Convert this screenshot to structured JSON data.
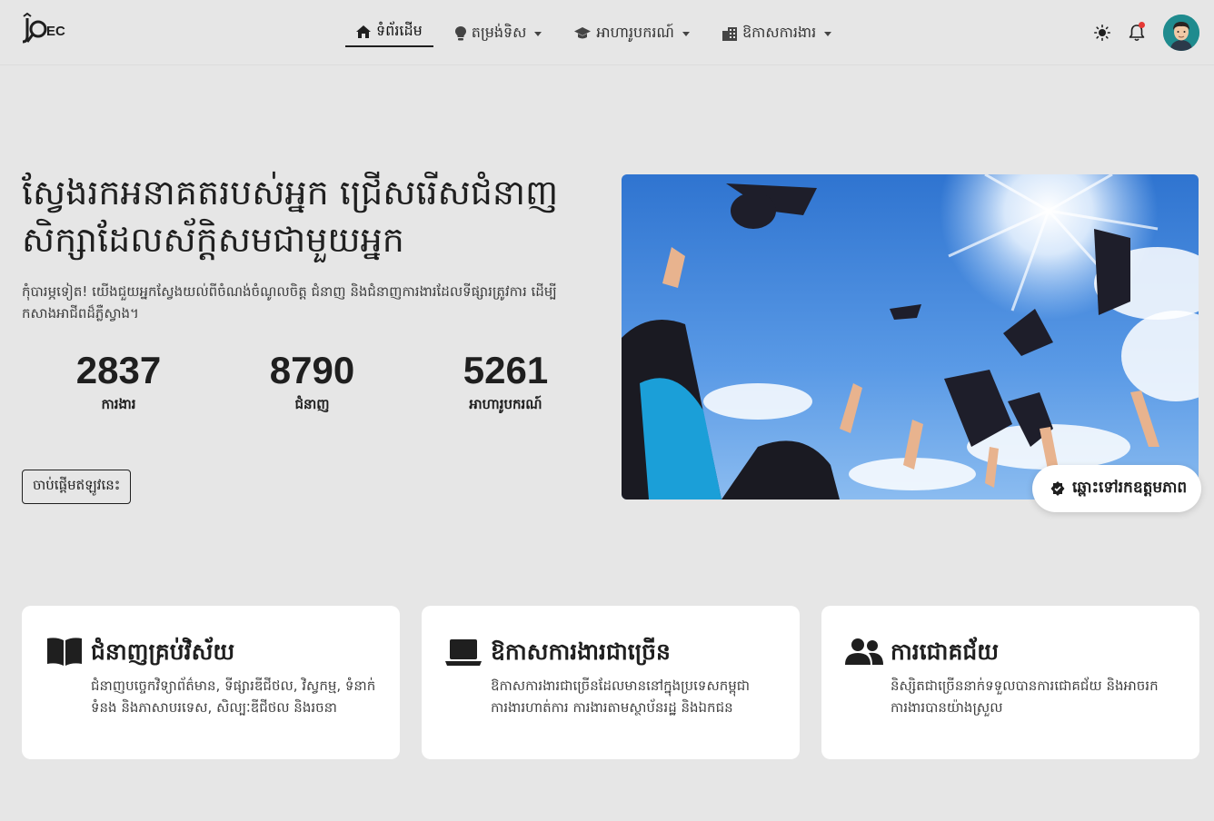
{
  "brand": {
    "logo_text": "JOEC"
  },
  "nav": {
    "items": [
      {
        "label": "ទំព័រដើម",
        "icon": "home-icon",
        "active": true,
        "dropdown": false
      },
      {
        "label": "តម្រង់ទិស",
        "icon": "lightbulb-icon",
        "active": false,
        "dropdown": true
      },
      {
        "label": "អាហារូបករណ៍",
        "icon": "graduation-cap-icon",
        "active": false,
        "dropdown": true
      },
      {
        "label": "ឱកាសការងារ",
        "icon": "building-icon",
        "active": false,
        "dropdown": true
      }
    ],
    "right": {
      "theme_icon": "sun-icon",
      "notification_icon": "bell-icon",
      "has_notification": true
    }
  },
  "hero": {
    "title": "ស្វែងរកអនាគតរបស់អ្នក ជ្រើសរើសជំនាញសិក្សាដែលស័ក្តិសមជាមួយអ្នក",
    "description": "កុំបារម្ភទៀត! យើងជួយអ្នកស្វែងយល់ពីចំណង់ចំណូលចិត្ត ជំនាញ និងជំនាញការងារដែលទីផ្សារត្រូវការ ដើម្បីកសាងអាជីពដ៏ភ្លឺស្វាង។",
    "stats": [
      {
        "value": "2837",
        "label": "ការងារ"
      },
      {
        "value": "8790",
        "label": "ជំនាញ"
      },
      {
        "value": "5261",
        "label": "អាហារូបករណ៍"
      }
    ],
    "cta_label": "ចាប់ផ្តើមឥឡូវនេះ",
    "badge_label": "ឆ្ពោះទៅរកឧត្តមភាព"
  },
  "features": [
    {
      "icon": "open-book-icon",
      "title": "ជំនាញគ្រប់វិស័យ",
      "text": "ជំនាញបច្ចេកវិទ្យាព័ត៌មាន, ទីផ្សារឌីជីថល, វិស្វកម្ម, ទំនាក់ទំនង និងភាសាបរទេស, សិល្បៈឌីជីថល និងរចនា"
    },
    {
      "icon": "laptop-icon",
      "title": "ឱកាសការងារជាច្រើន",
      "text": "ឱកាសការងារជាច្រើនដែលមាននៅក្នុងប្រទេសកម្ពុជា ការងារហាត់ការ ការងារតាមស្ថាប័នរដ្ឋ និងឯកជន"
    },
    {
      "icon": "users-icon",
      "title": "ការជោគជ័យ",
      "text": "និស្សិតជាច្រើននាក់ទទួលបានការជោគជ័យ និងអាចរកការងារបានយ៉ាងស្រួល"
    }
  ],
  "colors": {
    "background": "#e6e6e6",
    "card": "#ffffff",
    "text": "#1f1f1f",
    "notification": "#e53935",
    "avatar": "#1f8b8e"
  }
}
